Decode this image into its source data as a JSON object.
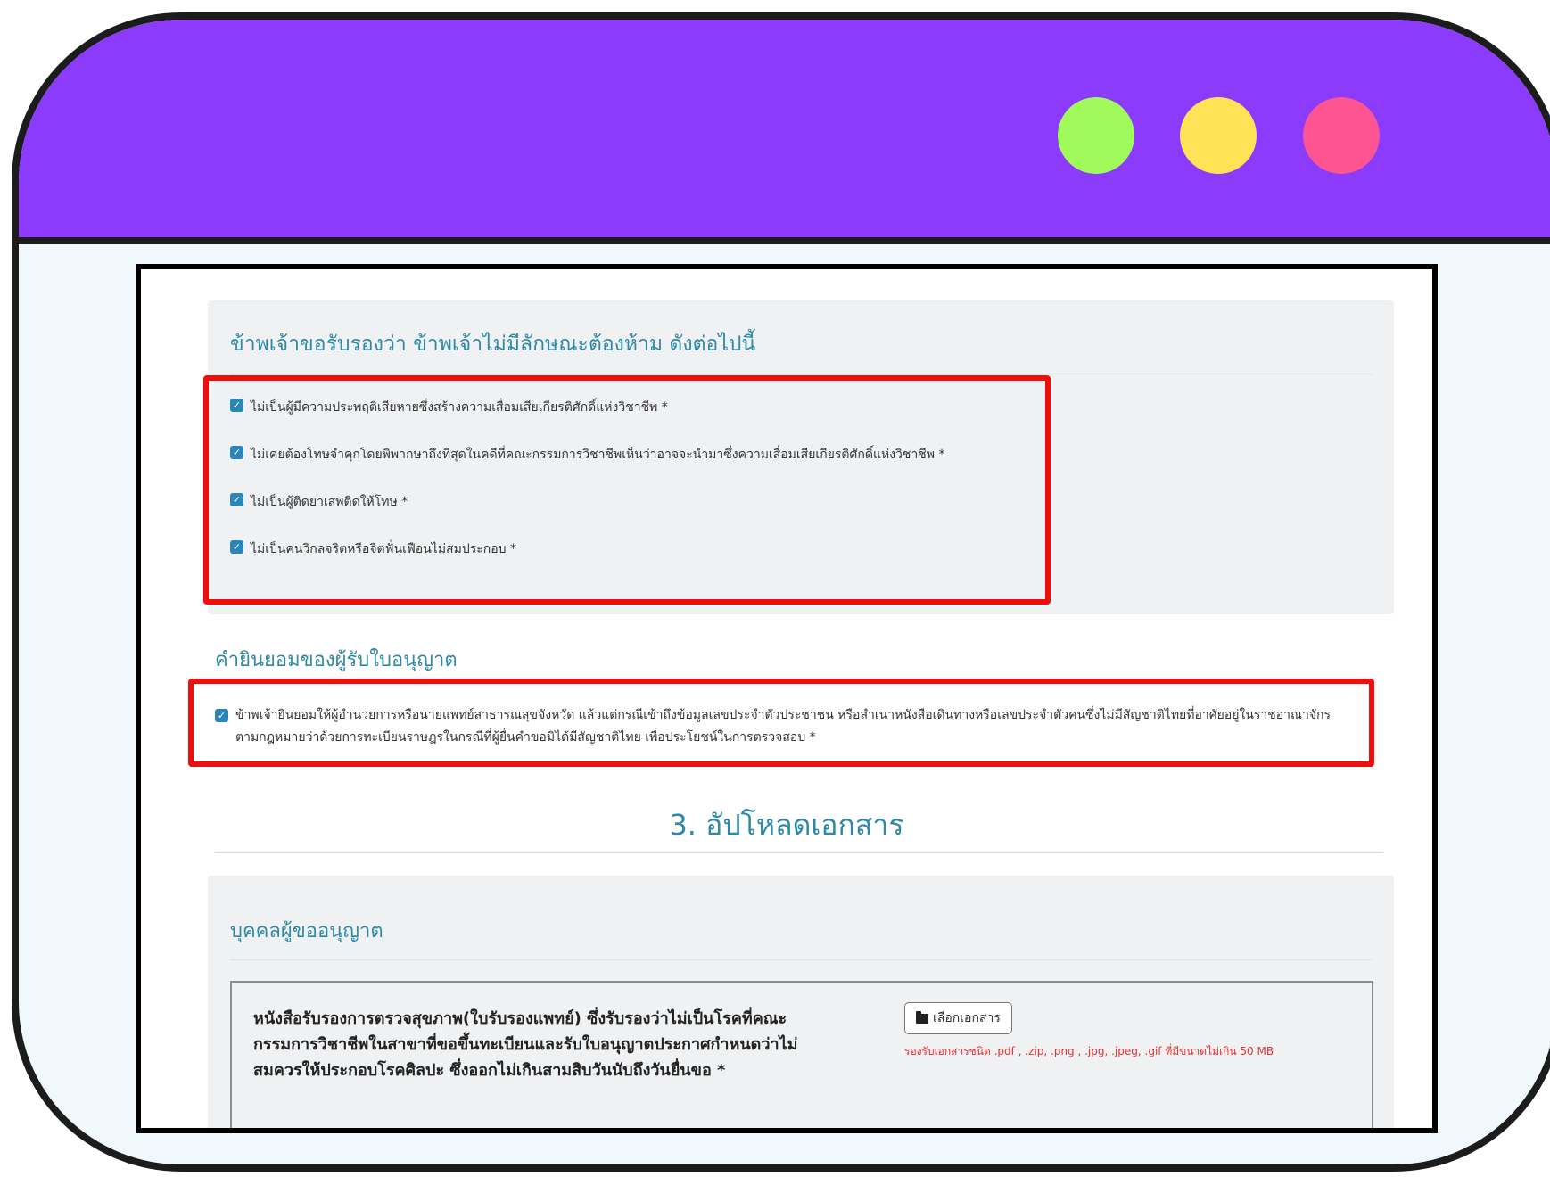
{
  "window": {
    "controls": [
      {
        "name": "green-dot",
        "color": "#a0fa5c"
      },
      {
        "name": "yellow-dot",
        "color": "#ffe255"
      },
      {
        "name": "pink-dot",
        "color": "#ff5492"
      }
    ],
    "titlebar_color": "#8c3afc"
  },
  "declaration": {
    "title": "ข้าพเจ้าขอรับรองว่า ข้าพเจ้าไม่มีลักษณะต้องห้าม ดังต่อไปนี้",
    "items": [
      {
        "label": "ไม่เป็นผู้มีความประพฤติเสียหายซึ่งสร้างความเสื่อมเสียเกียรติศักดิ์แห่งวิชาชีพ *",
        "checked": true
      },
      {
        "label": "ไม่เคยต้องโทษจำคุกโดยพิพากษาถึงที่สุดในคดีที่คณะกรรมการวิชาชีพเห็นว่าอาจจะนำมาซึ่งความเสื่อมเสียเกียรติศักดิ์แห่งวิชาชีพ *",
        "checked": true
      },
      {
        "label": "ไม่เป็นผู้ติดยาเสพติดให้โทษ *",
        "checked": true
      },
      {
        "label": "ไม่เป็นคนวิกลจริตหรือจิตฟั่นเฟือนไม่สมประกอบ *",
        "checked": true
      }
    ]
  },
  "consent": {
    "title": "คำยินยอมของผู้รับใบอนุญาต",
    "label": "ข้าพเจ้ายินยอมให้ผู้อำนวยการหรือนายแพทย์สาธารณสุขจังหวัด แล้วแต่กรณีเข้าถึงข้อมูลเลขประจำตัวประชาชน หรือสำเนาหนังสือเดินทางหรือเลขประจำตัวคนซึ่งไม่มีสัญชาติไทยที่อาศัยอยู่ในราชอาณาจักร ตามกฎหมายว่าด้วยการทะเบียนราษฎรในกรณีที่ผู้ยื่นคำขอมิได้มีสัญชาติไทย เพื่อประโยชน์ในการตรวจสอบ *",
    "checked": true
  },
  "upload": {
    "section_title": "3. อัปโหลดเอกสาร",
    "applicant_title": "บุคคลผู้ขออนุญาต",
    "document_label": "หนังสือรับรองการตรวจสุขภาพ(ใบรับรองแพทย์) ซึ่งรับรองว่าไม่เป็นโรคที่คณะกรรมการวิชาชีพในสาขาที่ขอขึ้นทะเบียนและรับใบอนุญาตประกาศกำหนดว่าไม่สมควรให้ประกอบโรคศิลปะ ซึ่งออกไม่เกินสามสิบวันนับถึงวันยื่นขอ *",
    "choose_button": "เลือกเอกสาร",
    "file_note": "รองรับเอกสารชนิด .pdf , .zip, .png , .jpg, .jpeg, .gif ที่มีขนาดไม่เกิน 50 MB"
  },
  "colors": {
    "accent_teal": "#2e89a6",
    "highlight_red": "#f20d0d",
    "checkbox_blue": "#2c85b8"
  }
}
